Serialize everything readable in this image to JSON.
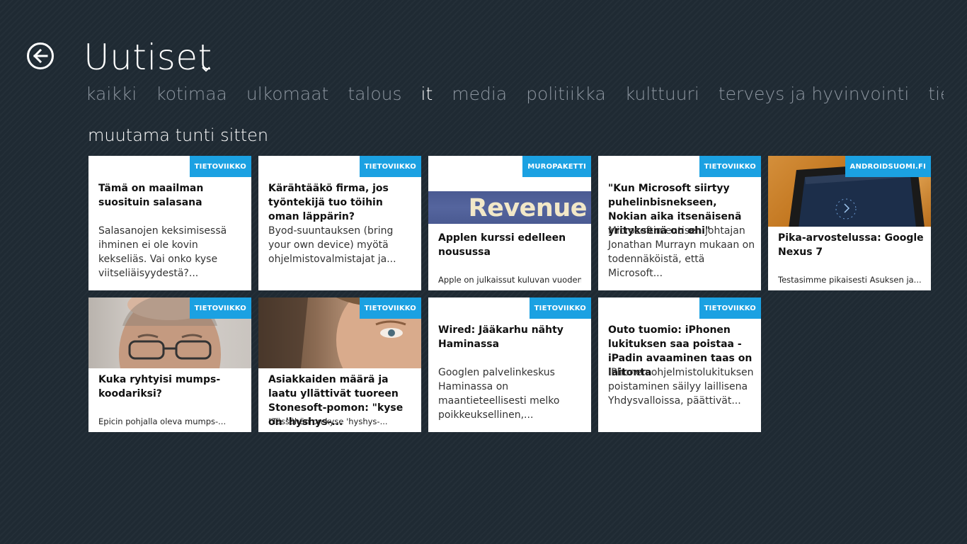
{
  "app": {
    "title": "Uutiset",
    "back_icon": "back-arrow-icon",
    "title_dropdown_icon": "chevron-down-icon"
  },
  "categories": [
    {
      "label": "kaikki",
      "active": false
    },
    {
      "label": "kotimaa",
      "active": false
    },
    {
      "label": "ulkomaat",
      "active": false
    },
    {
      "label": "talous",
      "active": false
    },
    {
      "label": "it",
      "active": true
    },
    {
      "label": "media",
      "active": false
    },
    {
      "label": "politiikka",
      "active": false
    },
    {
      "label": "kulttuuri",
      "active": false
    },
    {
      "label": "terveys ja hyvinvointi",
      "active": false
    },
    {
      "label": "tiede ja tutkimus",
      "active": false
    }
  ],
  "section": {
    "title": "muutama tunti sitten"
  },
  "colors": {
    "background": "#1f2a33",
    "badge": "#1ba1e2",
    "inactive_category": "#8d96a0",
    "active_category": "#ffffff"
  },
  "tiles": [
    {
      "source": "TIETOVIIKKO",
      "title": "Tämä on maailman suosituin salasana",
      "body": "Salasanojen keksimisessä ihminen ei ole kovin kekseliäs. Vai onko kyse viitseliäisyydestä?...",
      "footer": ""
    },
    {
      "source": "TIETOVIIKKO",
      "title": "Kärähtääkö firma, jos työntekijä tuo töihin oman läppärin?",
      "body": "Byod-suuntauksen (bring your own device) myötä ohjelmistovalmistajat ja...",
      "footer": ""
    },
    {
      "source": "MUROPAKETTI",
      "image_text": "Revenue",
      "title": "Applen kurssi edelleen nousussa",
      "body": "",
      "footer": "Apple on julkaissut kuluvan vuoden..."
    },
    {
      "source": "TIETOVIIKKO",
      "title": "\"Kun Microsoft siirtyy puhelinbisnekseen, Nokian aika itsenäisenä yrityksenä on ohi\"",
      "body": "Microsoftin entisen johtajan Jonathan Murrayn mukaan on todennäköistä, että Microsoft...",
      "footer": ""
    },
    {
      "source": "ANDROIDSUOMI.FI",
      "title": "Pika-arvostelussa: Google Nexus 7",
      "body": "",
      "footer": "Testasimme pikaisesti Asuksen ja..."
    },
    {
      "source": "TIETOVIIKKO",
      "title": "Kuka ryhtyisi mumps-koodariksi?",
      "body": "",
      "footer": "Epicin pohjalla oleva mumps-..."
    },
    {
      "source": "TIETOVIIKKO",
      "title": "Asiakkaiden määrä ja laatu yllättivät tuoreen Stonesoft-pomon: \"kyse on 'hyshys-...",
      "body": "",
      "footer": "\"Tässähän on kyse 'hyshys-..."
    },
    {
      "source": "TIETOVIIKKO",
      "title": "Wired: Jääkarhu nähty Haminassa",
      "body": "Googlen palvelinkeskus Haminassa on maantieteellisesti melko poikkeuksellinen,...",
      "footer": ""
    },
    {
      "source": "TIETOVIIKKO",
      "title": "Outo tuomio: iPhonen lukituksen saa poistaa - iPadin avaaminen taas on laitonta",
      "body": "IPhonen ohjelmistolukituksen poistaminen säilyy laillisena Yhdysvalloissa, päättivät...",
      "footer": ""
    }
  ]
}
